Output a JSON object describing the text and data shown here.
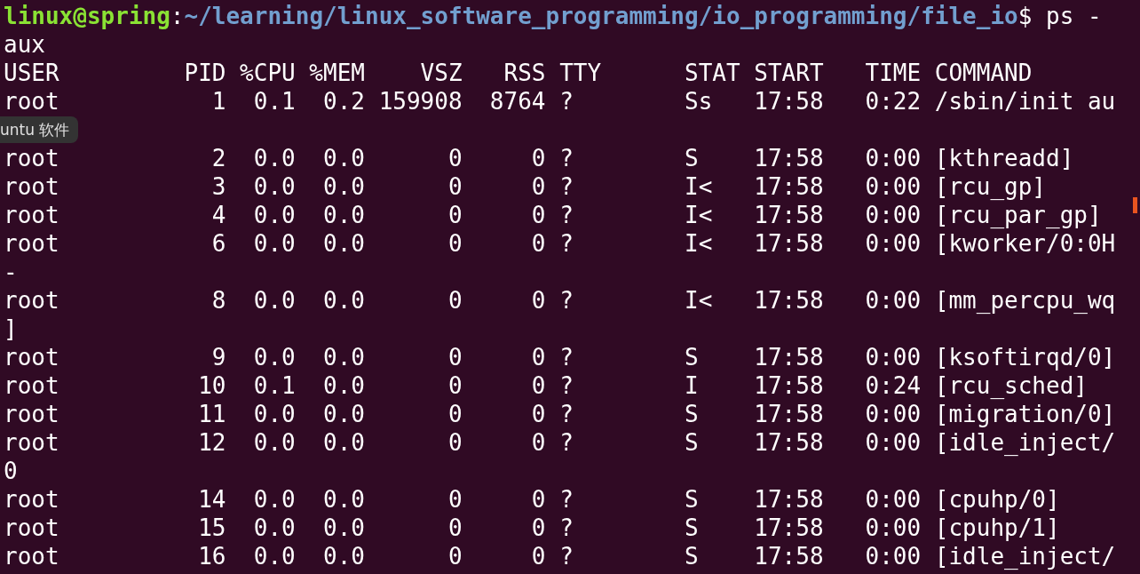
{
  "terminal": {
    "prompt": {
      "user_host": "linux@spring",
      "separator": ":",
      "path": "~/learning/linux_software_programming/io_programming/file_io",
      "command": "$ ps -"
    },
    "lines": [
      {
        "kind": "output",
        "text": "aux"
      },
      {
        "kind": "output",
        "text": "USER         PID %CPU %MEM    VSZ   RSS TTY      STAT START   TIME COMMAND"
      },
      {
        "kind": "output",
        "text": "root           1  0.1  0.2 159908  8764 ?        Ss   17:58   0:22 /sbin/init au"
      },
      {
        "kind": "tooltip",
        "text": "untu 软件"
      },
      {
        "kind": "output",
        "text": "root           2  0.0  0.0      0     0 ?        S    17:58   0:00 [kthreadd]"
      },
      {
        "kind": "output",
        "text": "root           3  0.0  0.0      0     0 ?        I<   17:58   0:00 [rcu_gp]"
      },
      {
        "kind": "output",
        "text": "root           4  0.0  0.0      0     0 ?        I<   17:58   0:00 [rcu_par_gp]"
      },
      {
        "kind": "output",
        "text": "root           6  0.0  0.0      0     0 ?        I<   17:58   0:00 [kworker/0:0H"
      },
      {
        "kind": "output",
        "text": "-"
      },
      {
        "kind": "output",
        "text": "root           8  0.0  0.0      0     0 ?        I<   17:58   0:00 [mm_percpu_wq"
      },
      {
        "kind": "output",
        "text": "]"
      },
      {
        "kind": "output",
        "text": "root           9  0.0  0.0      0     0 ?        S    17:58   0:00 [ksoftirqd/0]"
      },
      {
        "kind": "output",
        "text": "root          10  0.1  0.0      0     0 ?        I    17:58   0:24 [rcu_sched]"
      },
      {
        "kind": "output",
        "text": "root          11  0.0  0.0      0     0 ?        S    17:58   0:00 [migration/0]"
      },
      {
        "kind": "output",
        "text": "root          12  0.0  0.0      0     0 ?        S    17:58   0:00 [idle_inject/"
      },
      {
        "kind": "output",
        "text": "0"
      },
      {
        "kind": "output",
        "text": "root          14  0.0  0.0      0     0 ?        S    17:58   0:00 [cpuhp/0]"
      },
      {
        "kind": "output",
        "text": "root          15  0.0  0.0      0     0 ?        S    17:58   0:00 [cpuhp/1]"
      },
      {
        "kind": "output",
        "text": "root          16  0.0  0.0      0     0 ?        S    17:58   0:00 [idle_inject/"
      }
    ]
  }
}
